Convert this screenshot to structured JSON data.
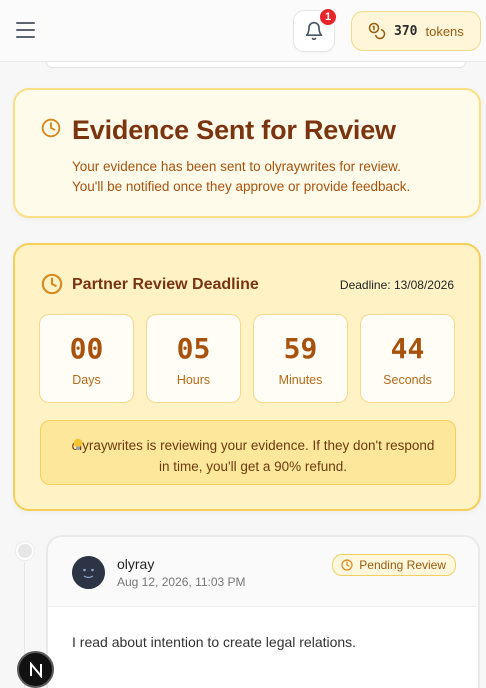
{
  "header": {
    "notifications_count": "1",
    "tokens_count": "370",
    "tokens_label": "tokens"
  },
  "evidence_card": {
    "title": "Evidence Sent for Review",
    "message_line1": "Your evidence has been sent to olyraywrites for review.",
    "message_line2": "You'll be notified once they approve or provide feedback."
  },
  "deadline_card": {
    "title": "Partner Review Deadline",
    "deadline": "Deadline: 13/08/2026",
    "countdown": [
      {
        "value": "00",
        "label": "Days"
      },
      {
        "value": "05",
        "label": "Hours"
      },
      {
        "value": "59",
        "label": "Minutes"
      },
      {
        "value": "44",
        "label": "Seconds"
      }
    ],
    "notice": "olyraywrites is reviewing your evidence. If they don't respond in time, you'll get a 90% refund."
  },
  "submission": {
    "user_name": "olyray",
    "timestamp": "Aug 12, 2026, 11:03 PM",
    "status": "Pending Review",
    "text": "I read about intention to create legal relations."
  },
  "floating_badge": {
    "letter": "N"
  },
  "colors": {
    "accent_brown": "#7a3410",
    "accent_orange": "#d9861b",
    "card_bg_light": "#fffbea",
    "card_bg_yellow": "#fff3c6",
    "badge_red": "#e5252a"
  },
  "icons": {
    "menu": "hamburger-icon",
    "bell": "bell-icon",
    "tokens": "coins-icon",
    "clock": "clock-icon",
    "bulb": "lightbulb-icon"
  }
}
